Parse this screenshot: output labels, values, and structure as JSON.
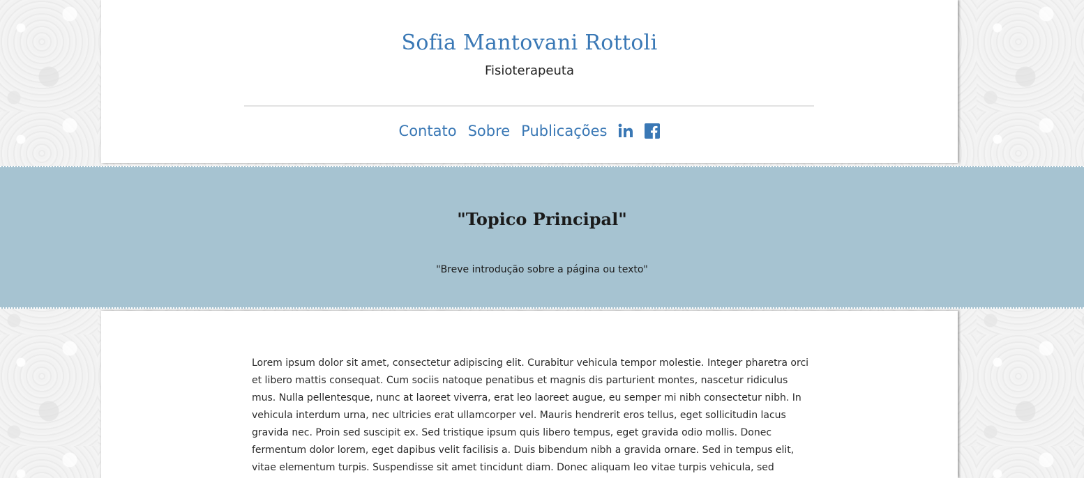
{
  "header": {
    "title": "Sofia Mantovani Rottoli",
    "subtitle": "Fisioterapeuta"
  },
  "nav": {
    "items": [
      {
        "label": "Contato"
      },
      {
        "label": "Sobre"
      },
      {
        "label": "Publicações"
      }
    ],
    "social": [
      {
        "icon": "linkedin-icon",
        "label": "in"
      },
      {
        "icon": "facebook-icon"
      }
    ]
  },
  "hero": {
    "title": "\"Topico Principal\"",
    "intro": "\"Breve introdução sobre a página ou texto\""
  },
  "content": {
    "paragraph": "Lorem ipsum dolor sit amet, consectetur adipiscing elit. Curabitur vehicula tempor molestie. Integer pharetra orci et libero mattis consequat. Cum sociis natoque penatibus et magnis dis parturient montes, nascetur ridiculus mus. Nulla pellentesque, nunc at laoreet viverra, erat leo laoreet augue, eu semper mi nibh consectetur nibh. In vehicula interdum urna, nec ultricies erat ullamcorper vel. Mauris hendrerit eros tellus, eget sollicitudin lacus gravida nec. Proin sed suscipit ex. Sed tristique ipsum quis libero tempus, eget gravida odio mollis. Donec fermentum dolor lorem, eget dapibus velit facilisis a. Duis bibendum nibh a gravida ornare. Sed in tempus elit, vitae elementum turpis. Suspendisse sit amet tincidunt diam. Donec aliquam leo vitae turpis vehicula, sed rhoncus lacus venenatis."
  },
  "colors": {
    "accent": "#3a78b5",
    "hero_background": "#a6c3d1",
    "page_background": "#efefef"
  }
}
